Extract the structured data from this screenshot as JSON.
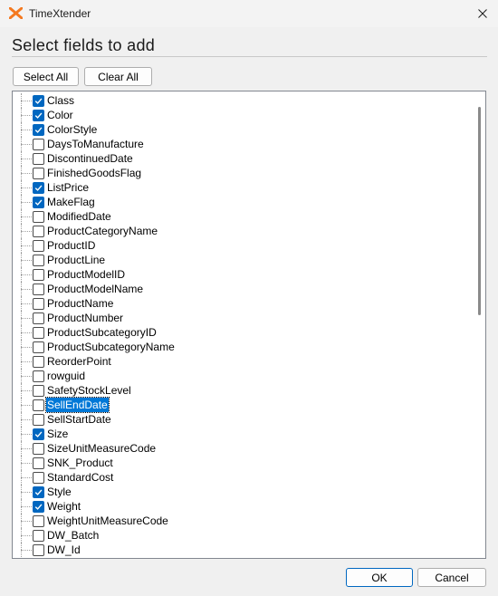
{
  "window": {
    "title": "TimeXtender",
    "close_icon": "close-icon",
    "app_icon": "timextender-logo-icon"
  },
  "heading": "Select fields to add",
  "buttons": {
    "select_all": "Select All",
    "clear_all": "Clear All",
    "ok": "OK",
    "cancel": "Cancel"
  },
  "colors": {
    "accent": "#0067c0",
    "selection": "#0078d7",
    "logo": "#f47920"
  },
  "fields": [
    {
      "label": "Class",
      "checked": true
    },
    {
      "label": "Color",
      "checked": true
    },
    {
      "label": "ColorStyle",
      "checked": true
    },
    {
      "label": "DaysToManufacture",
      "checked": false
    },
    {
      "label": "DiscontinuedDate",
      "checked": false
    },
    {
      "label": "FinishedGoodsFlag",
      "checked": false
    },
    {
      "label": "ListPrice",
      "checked": true
    },
    {
      "label": "MakeFlag",
      "checked": true
    },
    {
      "label": "ModifiedDate",
      "checked": false
    },
    {
      "label": "ProductCategoryName",
      "checked": false
    },
    {
      "label": "ProductID",
      "checked": false
    },
    {
      "label": "ProductLine",
      "checked": false
    },
    {
      "label": "ProductModelID",
      "checked": false
    },
    {
      "label": "ProductModelName",
      "checked": false
    },
    {
      "label": "ProductName",
      "checked": false
    },
    {
      "label": "ProductNumber",
      "checked": false
    },
    {
      "label": "ProductSubcategoryID",
      "checked": false
    },
    {
      "label": "ProductSubcategoryName",
      "checked": false
    },
    {
      "label": "ReorderPoint",
      "checked": false
    },
    {
      "label": "rowguid",
      "checked": false
    },
    {
      "label": "SafetyStockLevel",
      "checked": false
    },
    {
      "label": "SellEndDate",
      "checked": false,
      "selected": true
    },
    {
      "label": "SellStartDate",
      "checked": false
    },
    {
      "label": "Size",
      "checked": true
    },
    {
      "label": "SizeUnitMeasureCode",
      "checked": false
    },
    {
      "label": "SNK_Product",
      "checked": false
    },
    {
      "label": "StandardCost",
      "checked": false
    },
    {
      "label": "Style",
      "checked": true
    },
    {
      "label": "Weight",
      "checked": true
    },
    {
      "label": "WeightUnitMeasureCode",
      "checked": false
    },
    {
      "label": "DW_Batch",
      "checked": false
    },
    {
      "label": "DW_Id",
      "checked": false
    }
  ]
}
